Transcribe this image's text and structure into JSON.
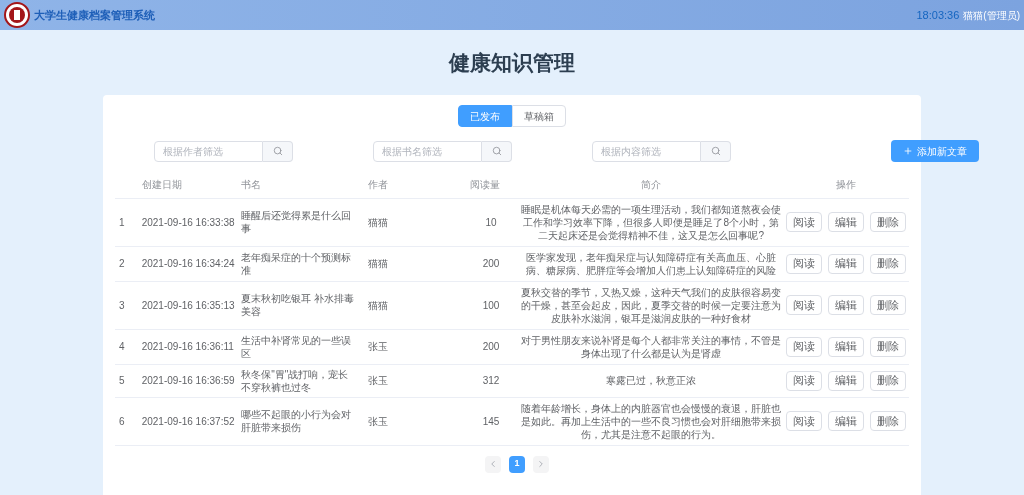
{
  "header": {
    "title": "大学生健康档案管理系统",
    "time": "18:03:36",
    "user": "猫猫(管理员)"
  },
  "page_title": "健康知识管理",
  "tabs": [
    {
      "label": "已发布",
      "selected": true
    },
    {
      "label": "草稿箱",
      "selected": false
    }
  ],
  "filters": [
    {
      "placeholder": "根据作者筛选"
    },
    {
      "placeholder": "根据书名筛选"
    },
    {
      "placeholder": "根据内容筛选"
    }
  ],
  "add_button": "添加新文章",
  "table": {
    "columns": [
      "创建日期",
      "书名",
      "作者",
      "阅读量",
      "简介",
      "操作"
    ],
    "rows": [
      {
        "index": "1",
        "date": "2021-09-16 16:33:38",
        "title": "睡醒后还觉得累是什么回事",
        "author": "猫猫",
        "reads": "10",
        "summary": "睡眠是机体每天必需的一项生理活动，我们都知道熬夜会使工作和学习效率下降，但很多人即便是睡足了8个小时，第二天起床还是会觉得精神不佳，这又是怎么回事呢?",
        "actions": [
          "阅读",
          "编辑",
          "删除"
        ]
      },
      {
        "index": "2",
        "date": "2021-09-16 16:34:24",
        "title": "老年痴呆症的十个预测标准",
        "author": "猫猫",
        "reads": "200",
        "summary": "医学家发现，老年痴呆症与认知障碍症有关高血压、心脏病、糖尿病、肥胖症等会增加人们患上认知障碍症的风险",
        "actions": [
          "阅读",
          "编辑",
          "删除"
        ]
      },
      {
        "index": "3",
        "date": "2021-09-16 16:35:13",
        "title": "夏末秋初吃银耳 补水排毒美容",
        "author": "猫猫",
        "reads": "100",
        "summary": "夏秋交替的季节，又热又燥，这种天气我们的皮肤很容易变的干燥，甚至会起皮，因此，夏季交替的时候一定要注意为皮肤补水滋润，银耳是滋润皮肤的一种好食材",
        "actions": [
          "阅读",
          "编辑",
          "删除"
        ]
      },
      {
        "index": "4",
        "date": "2021-09-16 16:36:11",
        "title": "生活中补肾常见的一些误区",
        "author": "张玉",
        "reads": "200",
        "summary": "对于男性朋友来说补肾是每个人都非常关注的事情，不管是身体出现了什么都是认为是肾虚",
        "actions": [
          "阅读",
          "编辑",
          "删除"
        ]
      },
      {
        "index": "5",
        "date": "2021-09-16 16:36:59",
        "title": "秋冬保\"胃\"战打响，宠长不穿秋裤也过冬",
        "author": "张玉",
        "reads": "312",
        "summary": "寒露已过，秋意正浓",
        "actions": [
          "阅读",
          "编辑",
          "删除"
        ]
      },
      {
        "index": "6",
        "date": "2021-09-16 16:37:52",
        "title": "哪些不起眼的小行为会对肝脏带来损伤",
        "author": "张玉",
        "reads": "145",
        "summary": "随着年龄增长，身体上的内脏器官也会慢慢的衰退，肝脏也是如此。再加上生活中的一些不良习惯也会对肝细胞带来损伤，尤其是注意不起眼的行为。",
        "actions": [
          "阅读",
          "编辑",
          "删除"
        ]
      }
    ]
  },
  "pagination": [
    {
      "label": "1",
      "selected": true
    }
  ]
}
